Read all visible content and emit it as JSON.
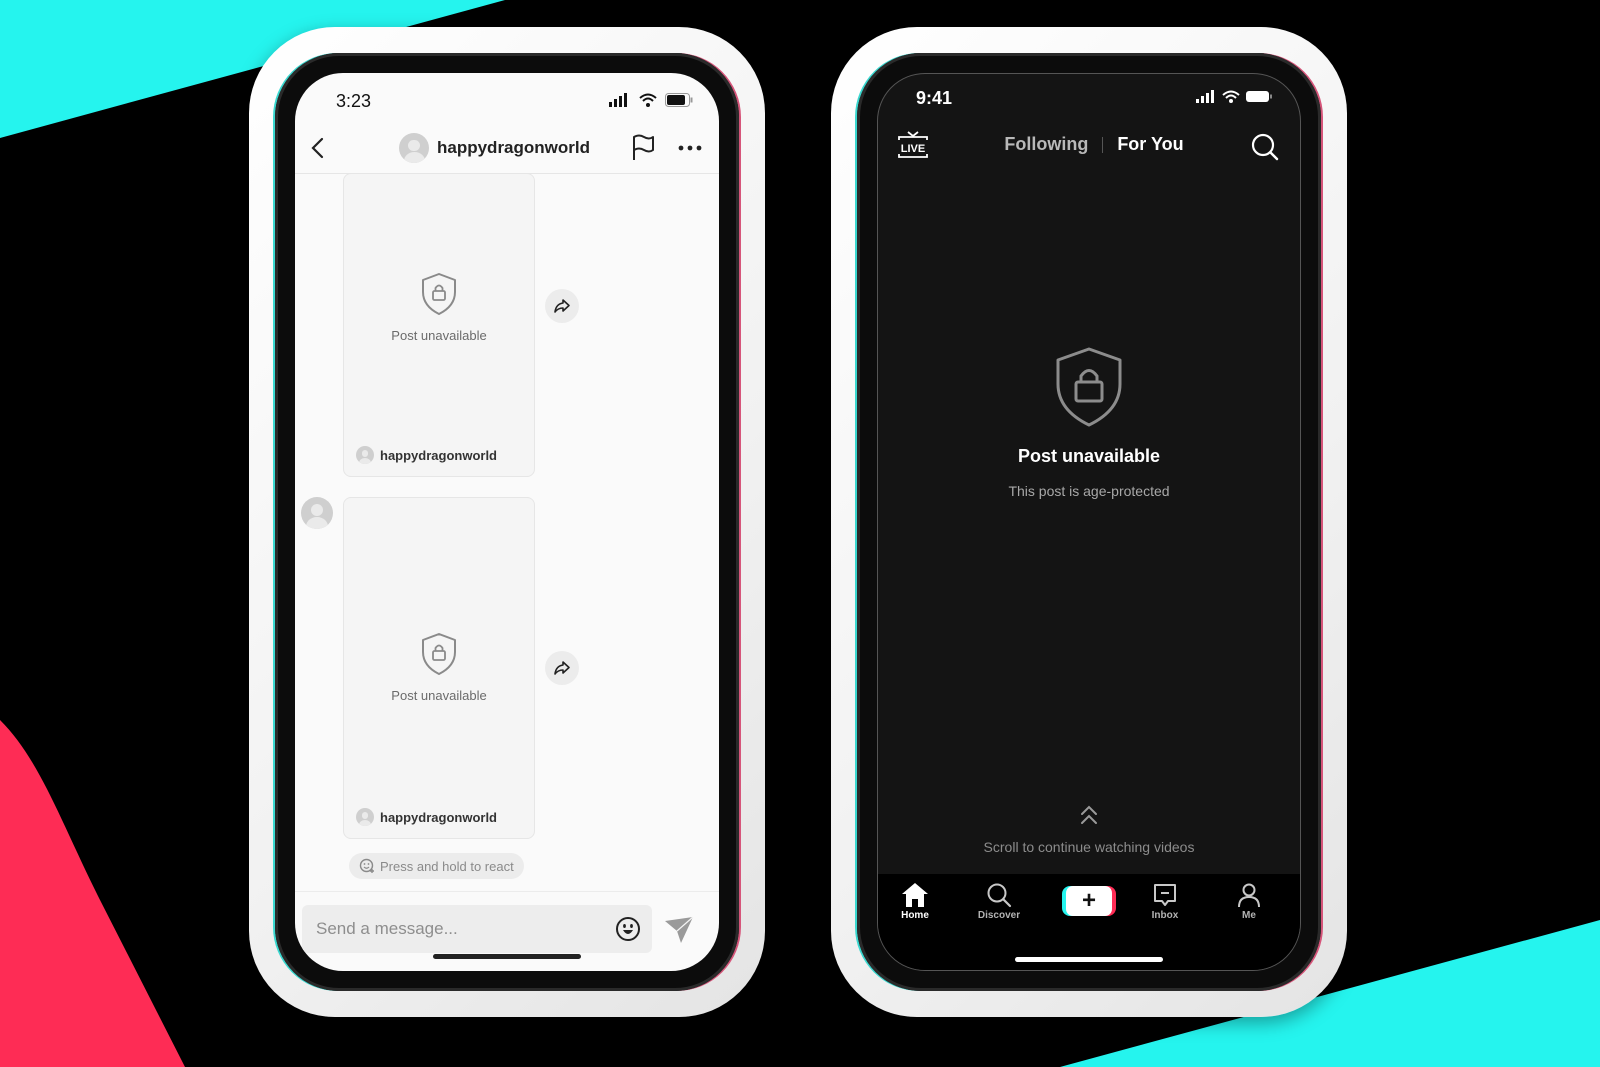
{
  "colors": {
    "tiktok_cyan": "#25f4ee",
    "tiktok_red": "#fe2c55",
    "background": "#000000"
  },
  "left_phone": {
    "status_bar": {
      "time": "3:23",
      "icons": [
        "signal-icon",
        "wifi-icon",
        "battery-icon"
      ]
    },
    "header": {
      "back_icon": "chevron-left-icon",
      "username": "happydragonworld",
      "report_icon": "flag-icon",
      "more_icon": "ellipsis-icon"
    },
    "messages": [
      {
        "status": "Post unavailable",
        "author": "happydragonworld",
        "icon": "shield-lock-icon",
        "share_icon": "share-icon"
      },
      {
        "status": "Post unavailable",
        "author": "happydragonworld",
        "icon": "shield-lock-icon",
        "share_icon": "share-icon"
      }
    ],
    "react_hint": "Press and hold to react",
    "composer": {
      "placeholder": "Send a message...",
      "emoji_icon": "emoji-icon",
      "send_icon": "send-icon"
    }
  },
  "right_phone": {
    "status_bar": {
      "time": "9:41",
      "icons": [
        "signal-icon",
        "wifi-icon",
        "battery-icon"
      ]
    },
    "top_bar": {
      "live_label": "LIVE",
      "tabs": [
        {
          "label": "Following",
          "active": false
        },
        {
          "label": "For You",
          "active": true
        }
      ],
      "search_icon": "search-icon"
    },
    "content": {
      "title": "Post unavailable",
      "subtitle": "This post is age-protected",
      "scroll_hint": "Scroll to continue watching videos"
    },
    "bottom_nav": [
      {
        "label": "Home",
        "icon": "home-icon",
        "active": true
      },
      {
        "label": "Discover",
        "icon": "search-icon",
        "active": false
      },
      {
        "label": "+",
        "icon": "create-icon",
        "active": false
      },
      {
        "label": "Inbox",
        "icon": "inbox-icon",
        "active": false
      },
      {
        "label": "Me",
        "icon": "profile-icon",
        "active": false
      }
    ]
  }
}
